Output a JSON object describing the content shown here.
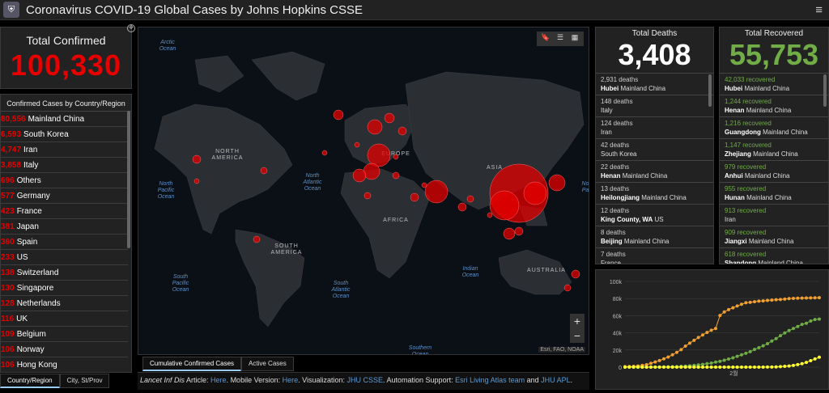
{
  "header": {
    "title": "Coronavirus COVID-19 Global Cases by Johns Hopkins CSSE",
    "logo_icon": "jhu-shield-icon",
    "menu_icon": "hamburger-menu-icon"
  },
  "total_confirmed": {
    "label": "Total Confirmed",
    "value": "100,330"
  },
  "country_list": {
    "heading": "Confirmed Cases by Country/Region",
    "rows": [
      {
        "n": "80,556",
        "c": "Mainland China"
      },
      {
        "n": "6,593",
        "c": "South Korea"
      },
      {
        "n": "4,747",
        "c": "Iran"
      },
      {
        "n": "3,858",
        "c": "Italy"
      },
      {
        "n": "696",
        "c": "Others"
      },
      {
        "n": "577",
        "c": "Germany"
      },
      {
        "n": "423",
        "c": "France"
      },
      {
        "n": "381",
        "c": "Japan"
      },
      {
        "n": "360",
        "c": "Spain"
      },
      {
        "n": "233",
        "c": "US"
      },
      {
        "n": "138",
        "c": "Switzerland"
      },
      {
        "n": "130",
        "c": "Singapore"
      },
      {
        "n": "128",
        "c": "Netherlands"
      },
      {
        "n": "116",
        "c": "UK"
      },
      {
        "n": "109",
        "c": "Belgium"
      },
      {
        "n": "106",
        "c": "Norway"
      },
      {
        "n": "106",
        "c": "Hong Kong"
      }
    ]
  },
  "list_tabs": [
    "Country/Region",
    "City, St/Prov"
  ],
  "map": {
    "labels": {
      "arctic": "Arctic\nOcean",
      "na": "NORTH\nAMERICA",
      "npac": "North\nPacific\nOcean",
      "natl": "North\nAtlantic\nOcean",
      "europe": "EUROPE",
      "asia": "ASIA",
      "africa": "AFRICA",
      "sa": "SOUTH\nAMERICA",
      "spac": "South\nPacific\nOcean",
      "satl": "South\nAtlantic\nOcean",
      "indian": "Indian\nOcean",
      "aus": "AUSTRALIA",
      "southern": "Southern\nOcean",
      "np": "No\nPa"
    },
    "attribution": "Esri, FAO, NOAA",
    "zoom_in": "+",
    "zoom_out": "−"
  },
  "map_tabs": [
    "Cumulative Confirmed Cases",
    "Active Cases"
  ],
  "bottom_text": {
    "t1": "Lancet Inf Dis",
    "t2": " Article: ",
    "l1": "Here",
    "t3": ". Mobile Version: ",
    "l2": "Here",
    "t4": ". Visualization: ",
    "l3": "JHU CSSE",
    "t5": ". Automation Support: ",
    "l4": "Esri Living Atlas team",
    "t6": " and ",
    "l5": "JHU APL",
    "t7": "."
  },
  "deaths": {
    "label": "Total Deaths",
    "value": "3,408",
    "items": [
      {
        "a": "2,931 deaths",
        "b": "Hubei",
        "c": "Mainland China"
      },
      {
        "a": "148 deaths",
        "b": "",
        "c": "Italy"
      },
      {
        "a": "124 deaths",
        "b": "",
        "c": "Iran"
      },
      {
        "a": "42 deaths",
        "b": "",
        "c": "South Korea"
      },
      {
        "a": "22 deaths",
        "b": "Henan",
        "c": "Mainland China"
      },
      {
        "a": "13 deaths",
        "b": "Heilongjiang",
        "c": "Mainland China"
      },
      {
        "a": "12 deaths",
        "b": "King County, WA",
        "c": "US"
      },
      {
        "a": "8 deaths",
        "b": "Beijing",
        "c": "Mainland China"
      },
      {
        "a": "7 deaths",
        "b": "",
        "c": "France"
      }
    ]
  },
  "recovered": {
    "label": "Total Recovered",
    "value": "55,753",
    "items": [
      {
        "a": "42,033 recovered",
        "b": "Hubei",
        "c": "Mainland China"
      },
      {
        "a": "1,244 recovered",
        "b": "Henan",
        "c": "Mainland China"
      },
      {
        "a": "1,216 recovered",
        "b": "Guangdong",
        "c": "Mainland China"
      },
      {
        "a": "1,147 recovered",
        "b": "Zhejiang",
        "c": "Mainland China"
      },
      {
        "a": "979 recovered",
        "b": "Anhui",
        "c": "Mainland China"
      },
      {
        "a": "955 recovered",
        "b": "Hunan",
        "c": "Mainland China"
      },
      {
        "a": "913 recovered",
        "b": "",
        "c": "Iran"
      },
      {
        "a": "909 recovered",
        "b": "Jiangxi",
        "c": "Mainland China"
      },
      {
        "a": "618 recovered",
        "b": "Shandong",
        "c": "Mainland China"
      }
    ]
  },
  "chart_data": {
    "type": "line",
    "yticks": [
      "100k",
      "80k",
      "60k",
      "40k",
      "20k",
      "0"
    ],
    "ylim": [
      0,
      100000
    ],
    "xtick": "2월",
    "series": [
      {
        "color": "#f0a030",
        "values": [
          550,
          650,
          900,
          1300,
          2000,
          2800,
          4500,
          6000,
          7700,
          9700,
          11800,
          14400,
          17200,
          20400,
          24500,
          28000,
          31200,
          34500,
          37500,
          40500,
          43000,
          45100,
          60300,
          64400,
          67100,
          69200,
          71300,
          73300,
          75100,
          75600,
          76300,
          77000,
          77200,
          77800,
          78200,
          78600,
          78900,
          79400,
          80000,
          80200,
          80400,
          80600,
          80700,
          80800,
          80900,
          81000
        ]
      },
      {
        "color": "#70ad47",
        "values": [
          0,
          0,
          0,
          0,
          30,
          50,
          60,
          100,
          130,
          200,
          300,
          500,
          600,
          900,
          1150,
          1500,
          2000,
          2600,
          3200,
          4000,
          4700,
          5900,
          6700,
          8000,
          9400,
          10800,
          12600,
          14400,
          16100,
          18000,
          20600,
          22700,
          24900,
          27300,
          30400,
          33300,
          36700,
          39800,
          42700,
          45000,
          47400,
          49900,
          51200,
          53800,
          55500,
          56000
        ]
      },
      {
        "color": "#ffff33",
        "values": [
          0,
          0,
          0,
          0,
          0,
          0,
          0,
          0,
          0,
          0,
          0,
          0,
          0,
          0,
          0,
          0,
          0,
          0,
          0,
          0,
          0,
          0,
          0,
          0,
          0,
          0,
          0,
          0,
          0,
          0,
          0,
          0,
          50,
          80,
          120,
          260,
          550,
          900,
          1300,
          2000,
          2900,
          4000,
          5500,
          7500,
          9500,
          11500
        ]
      }
    ]
  }
}
